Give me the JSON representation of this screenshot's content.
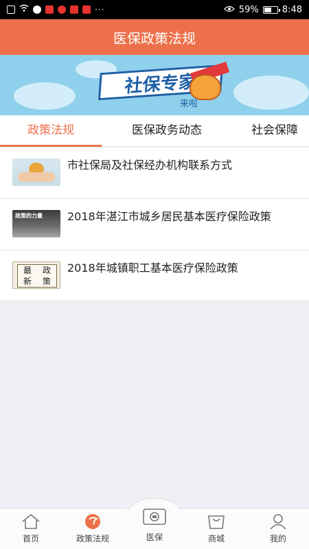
{
  "status_bar": {
    "battery": "59%",
    "time": "8:48",
    "battery_level": 0.59,
    "dots": "···"
  },
  "header": {
    "title": "医保政策法规"
  },
  "banner": {
    "title": "社保专家",
    "tag": "来啦"
  },
  "tabs": [
    {
      "label": "政策法规",
      "active": true
    },
    {
      "label": "医保政务动态",
      "active": false
    },
    {
      "label": "社会保障",
      "active": false
    }
  ],
  "articles": [
    {
      "title": "市社保局及社保经办机构联系方式",
      "thumb": "hands-holding-globe"
    },
    {
      "title": "2018年湛江市城乡居民基本医疗保险政策",
      "thumb": "power-of-policy",
      "thumb_caption": "政策的力量"
    },
    {
      "title": "2018年城镇职工基本医疗保险政策",
      "thumb": "newest-policy-book",
      "thumb_text": [
        "最",
        "政",
        "新",
        "策"
      ]
    }
  ],
  "bottom_nav": [
    {
      "label": "首页",
      "icon": "home-icon"
    },
    {
      "label": "政策法规",
      "icon": "policy-icon",
      "active": true
    },
    {
      "label": "医保",
      "icon": "medical-insurance-icon"
    },
    {
      "label": "商城",
      "icon": "shop-icon"
    },
    {
      "label": "我的",
      "icon": "profile-icon"
    }
  ],
  "colors": {
    "accent": "#ec714a",
    "background": "#eef0f6"
  }
}
